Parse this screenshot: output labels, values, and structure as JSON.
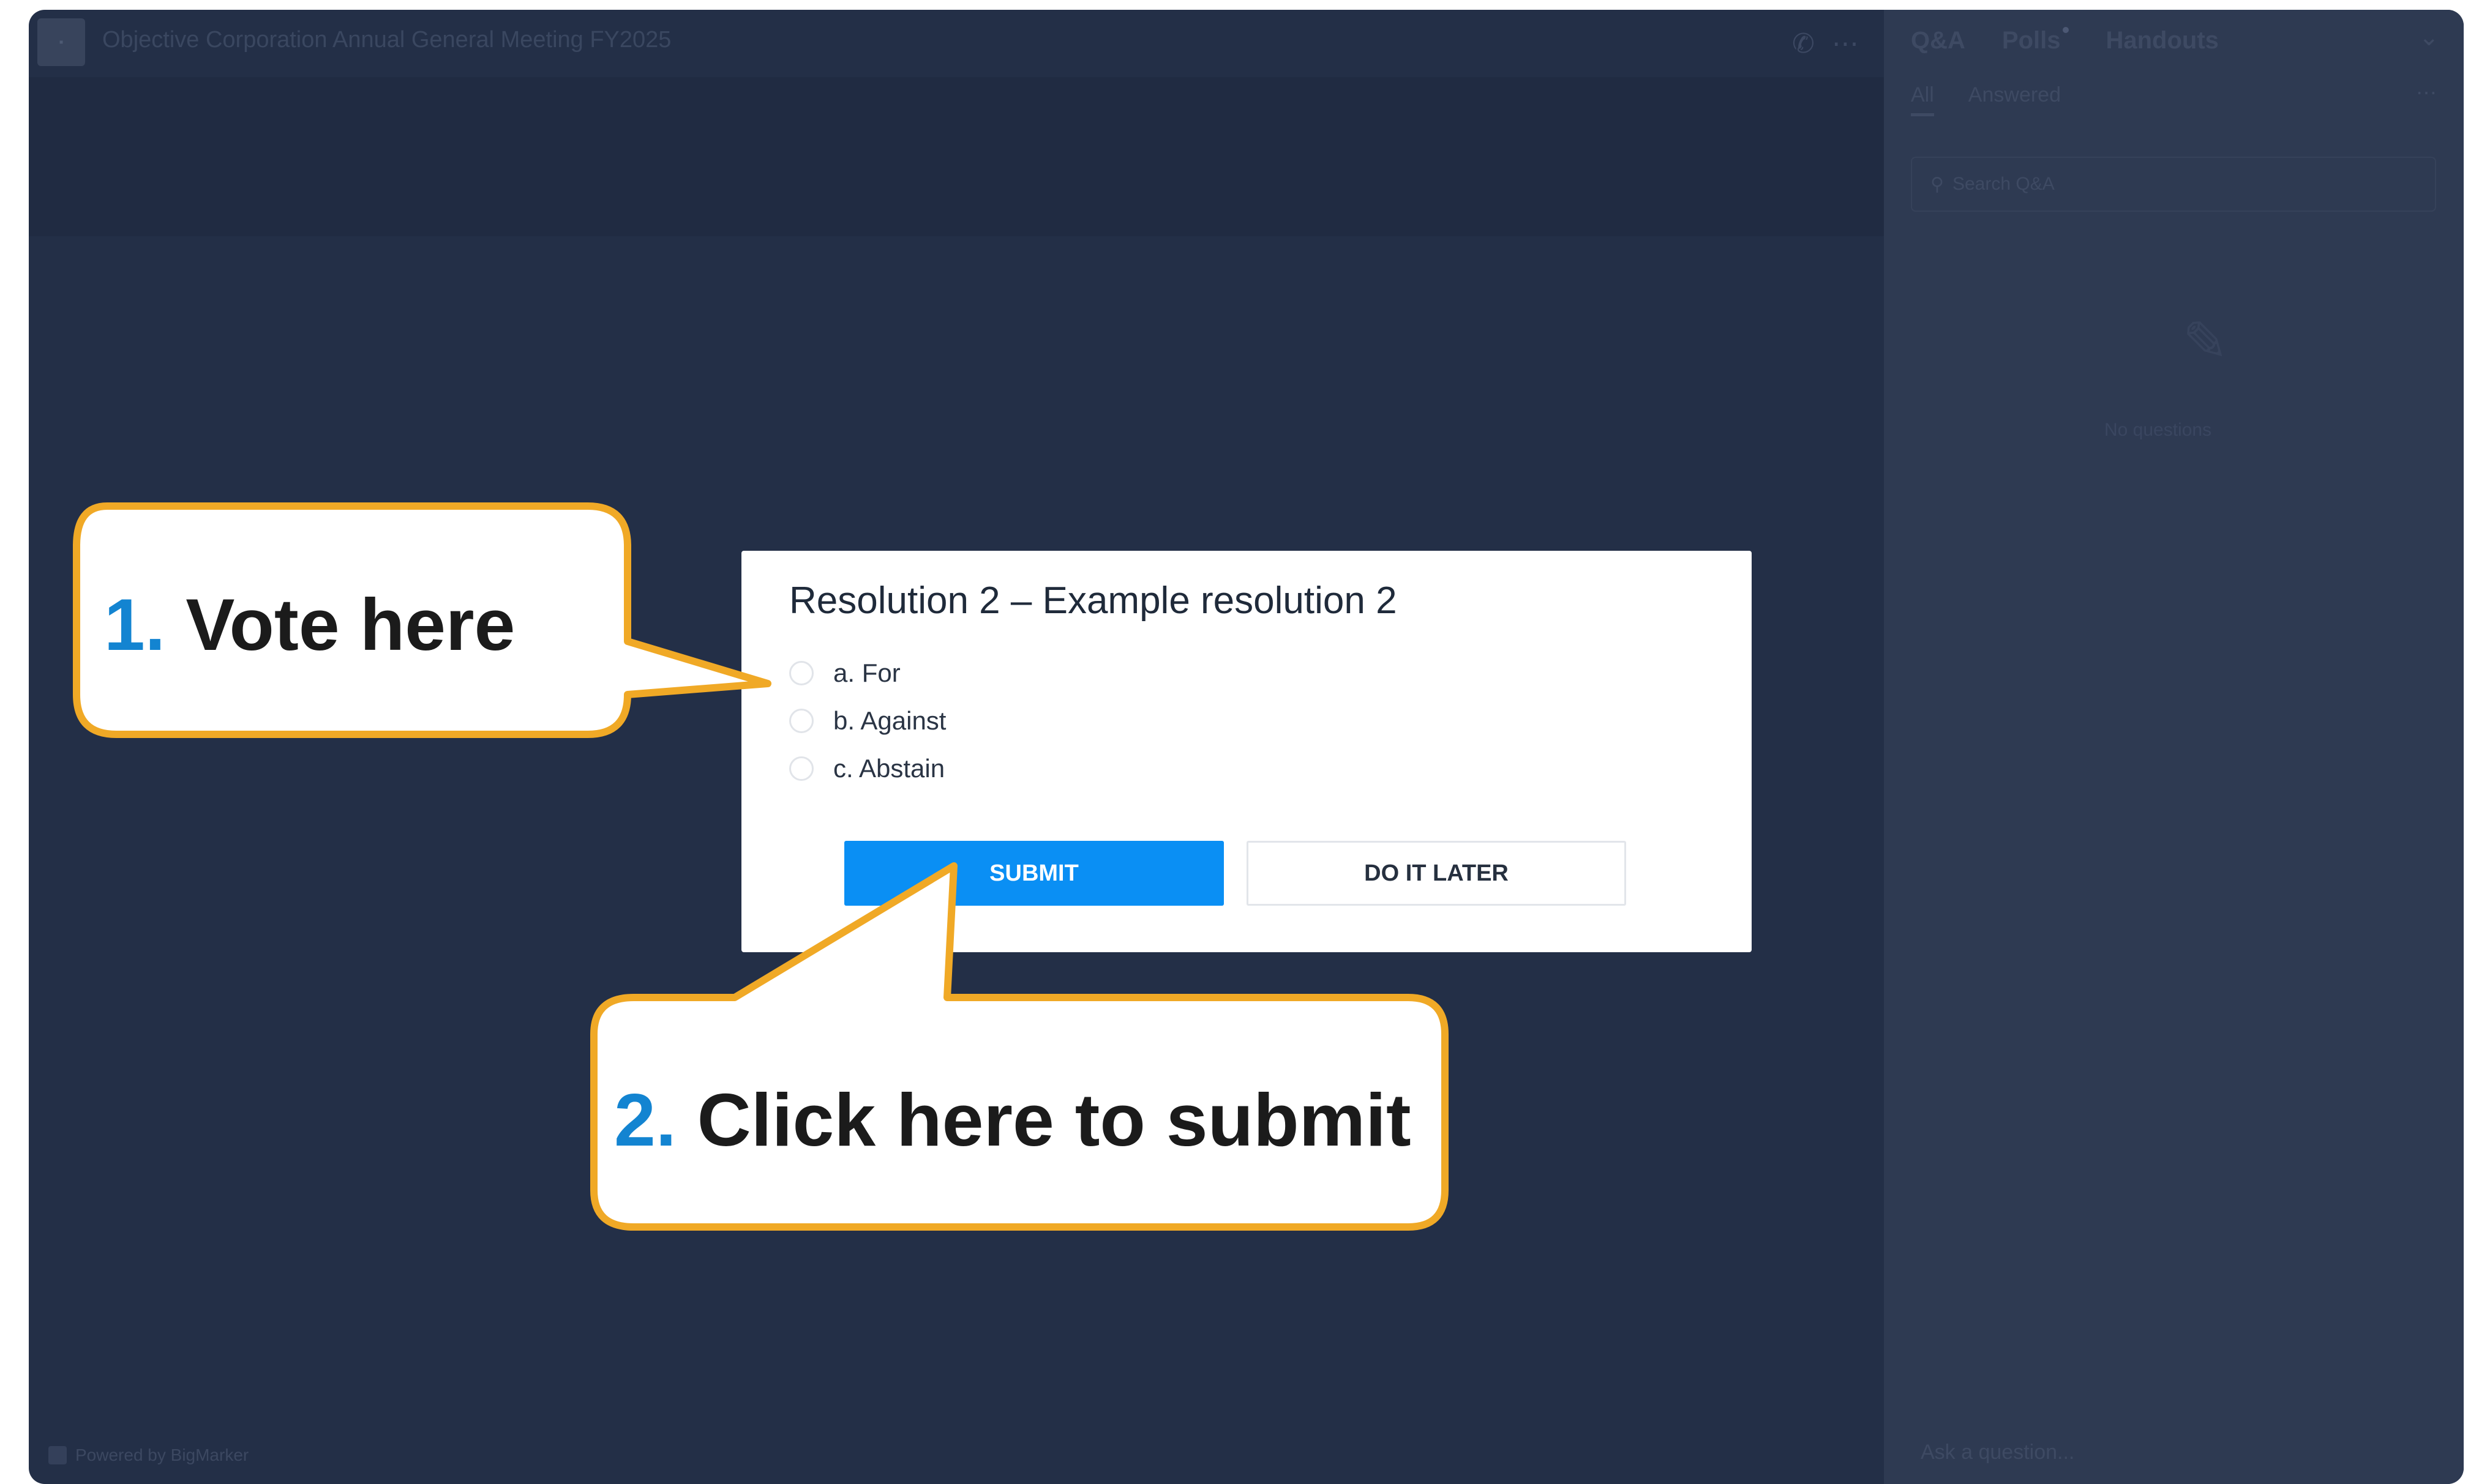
{
  "event": {
    "logo_text": "▪",
    "title": "Objective Corporation Annual General Meeting FY2025",
    "phone_icon": "phone-icon",
    "more_icon": "more-icon",
    "powered_by": "Powered by BigMarker"
  },
  "side_panel": {
    "tabs": [
      "Q&A",
      "Polls",
      "Handouts"
    ],
    "subtabs": [
      "All",
      "Answered"
    ],
    "search_placeholder": "Search Q&A",
    "empty_text": "No questions",
    "ask_placeholder": "Ask a question..."
  },
  "poll": {
    "title": "Resolution 2 – Example resolution 2",
    "options": [
      "a. For",
      "b. Against",
      "c. Abstain"
    ],
    "submit_label": "SUBMIT",
    "later_label": "DO IT LATER"
  },
  "callouts": {
    "vote": {
      "number": "1.",
      "text": "Vote here"
    },
    "submit": {
      "number": "2.",
      "text": "Click here to submit"
    }
  },
  "colors": {
    "callout_border": "#f0a926",
    "callout_number": "#1384d1",
    "submit_button": "#0a8ff4",
    "background": "#232f47"
  }
}
